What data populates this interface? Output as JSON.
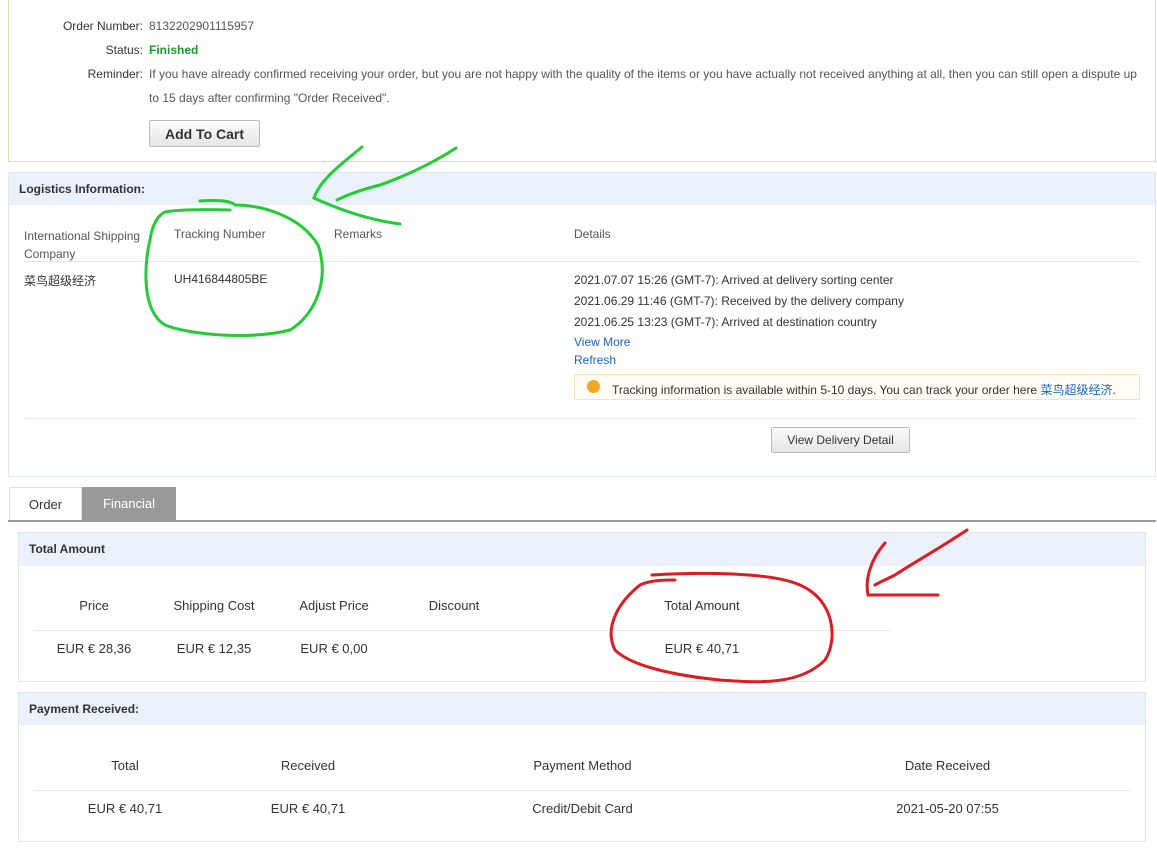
{
  "order": {
    "number_label": "Order Number:",
    "number": "8132202901115957",
    "status_label": "Status:",
    "status": "Finished",
    "reminder_label": "Reminder:",
    "reminder_line1": "If you have already confirmed receiving your order, but you are not happy with the quality of the items or you have actually not received anything at all, then you can still open a dispute up",
    "reminder_line2": "to 15 days after confirming \"Order Received\".",
    "add_to_cart": "Add To Cart"
  },
  "logistics": {
    "title": "Logistics Information:",
    "headers": [
      "International Shipping Company",
      "Tracking Number",
      "Remarks",
      "Details"
    ],
    "company": "菜鸟超级经济",
    "tracking": "UH416844805BE",
    "events": [
      "2021.07.07 15:26 (GMT-7): Arrived at delivery sorting center",
      "2021.06.29 11:46 (GMT-7): Received by the delivery company",
      "2021.06.25 13:23 (GMT-7): Arrived at destination country"
    ],
    "view_more": "View More",
    "refresh": "Refresh",
    "tip": "Tracking information is available within 5-10 days. You can track your order here ",
    "tip_link": "菜鸟超级经济",
    "tip_end": ".",
    "view_delivery": "View Delivery Detail"
  },
  "tabs": [
    {
      "label": "Order"
    },
    {
      "label": "Financial"
    }
  ],
  "total": {
    "title": "Total Amount",
    "headers": [
      "Price",
      "Shipping Cost",
      "Adjust Price",
      "Discount",
      "Total Amount"
    ],
    "values": [
      "EUR € 28,36",
      "EUR € 12,35",
      "EUR € 0,00",
      "",
      "EUR € 40,71"
    ]
  },
  "payment": {
    "title": "Payment Received:",
    "headers": [
      "Total",
      "Received",
      "Payment Method",
      "Date Received"
    ],
    "values": [
      "EUR € 40,71",
      "EUR € 40,71",
      "Credit/Debit Card",
      "2021-05-20 07:55"
    ]
  },
  "colors": {
    "status": "#1a9a2a",
    "link": "#1a66c7",
    "green_mark": "#22cc33",
    "red_mark": "#e01a22"
  }
}
